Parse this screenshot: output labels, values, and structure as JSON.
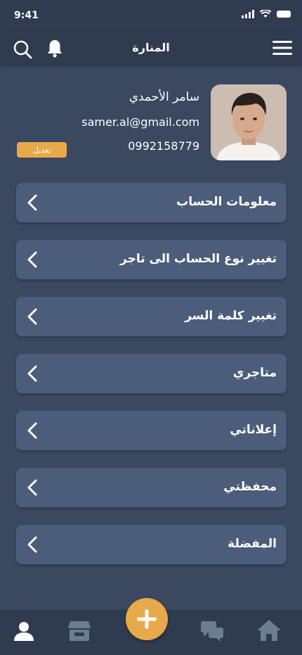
{
  "status_bar": {
    "time": "9:41"
  },
  "header": {
    "title": "المنارة"
  },
  "profile": {
    "name": "سامر الأحمدي",
    "email": "samer.al@gmail.com",
    "phone": "0992158779",
    "edit_label": "تعديل"
  },
  "menu": {
    "items": [
      {
        "label": "معلومات الحساب"
      },
      {
        "label": "تغيير نوع الحساب الى تاجر"
      },
      {
        "label": "تغيير كلمة السر"
      },
      {
        "label": "متاجري"
      },
      {
        "label": "إعلاناتي"
      },
      {
        "label": "محفظتي"
      },
      {
        "label": "المفضلة"
      }
    ]
  },
  "bottom_nav": {
    "items": [
      "profile-icon",
      "store-icon",
      "add-icon",
      "chat-icon",
      "home-icon"
    ],
    "active": "profile-icon"
  },
  "colors": {
    "background": "#3a4860",
    "bar": "#2f3b4f",
    "card": "#4b5d7a",
    "accent": "#e8a94b"
  }
}
